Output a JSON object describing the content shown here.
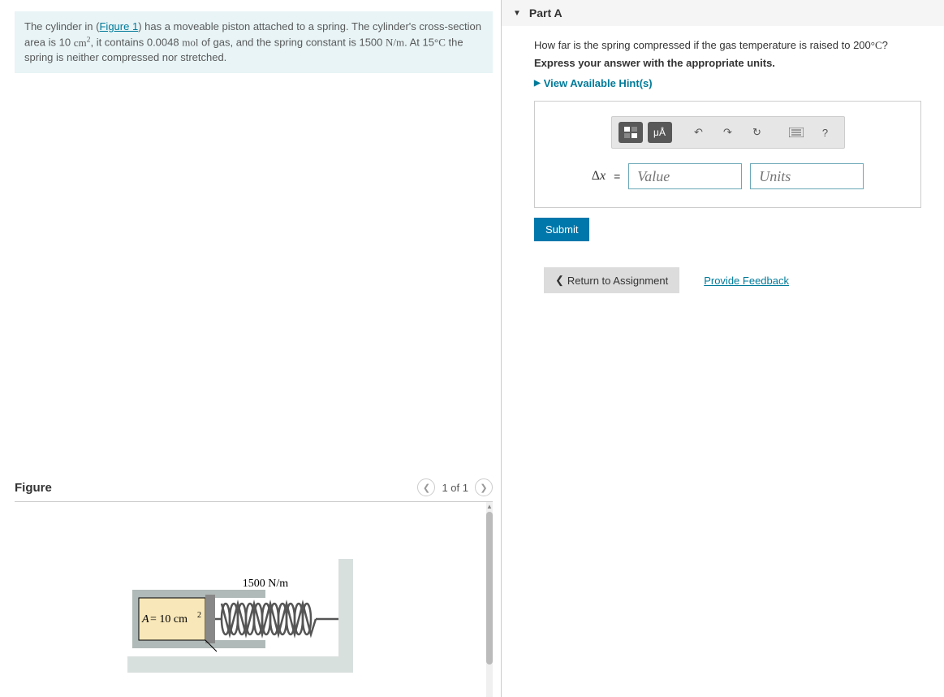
{
  "problem": {
    "intro_html": "The cylinder in (<a href='#' data-name='figure-link' data-interactable='true'>Figure 1</a>) has a moveable piston attached to a spring. The cylinder's cross-section area is 10 <span class='mf'>cm<sup>2</sup></span>, it contains 0.0048 <span class='mf'>mol</span> of gas, and the spring constant is 1500 <span class='mf'>N/m</span>. At 15<span class='mf'>°C</span> the spring is neither compressed nor stretched."
  },
  "figure": {
    "title": "Figure",
    "counter": "1 of 1",
    "spring_label": "1500 N/m",
    "area_label": "A = 10 cm²"
  },
  "part": {
    "label": "Part A",
    "question_html": "How far is the spring compressed if the gas temperature is raised to 200<span class='mf'>°C</span>?",
    "instruction": "Express your answer with the appropriate units.",
    "hints_label": "View Available Hint(s)",
    "variable": "Δx",
    "value_placeholder": "Value",
    "units_placeholder": "Units",
    "toolbar": {
      "units_btn": "μÅ",
      "help": "?"
    },
    "submit": "Submit"
  },
  "footer": {
    "return": "Return to Assignment",
    "feedback": "Provide Feedback"
  }
}
